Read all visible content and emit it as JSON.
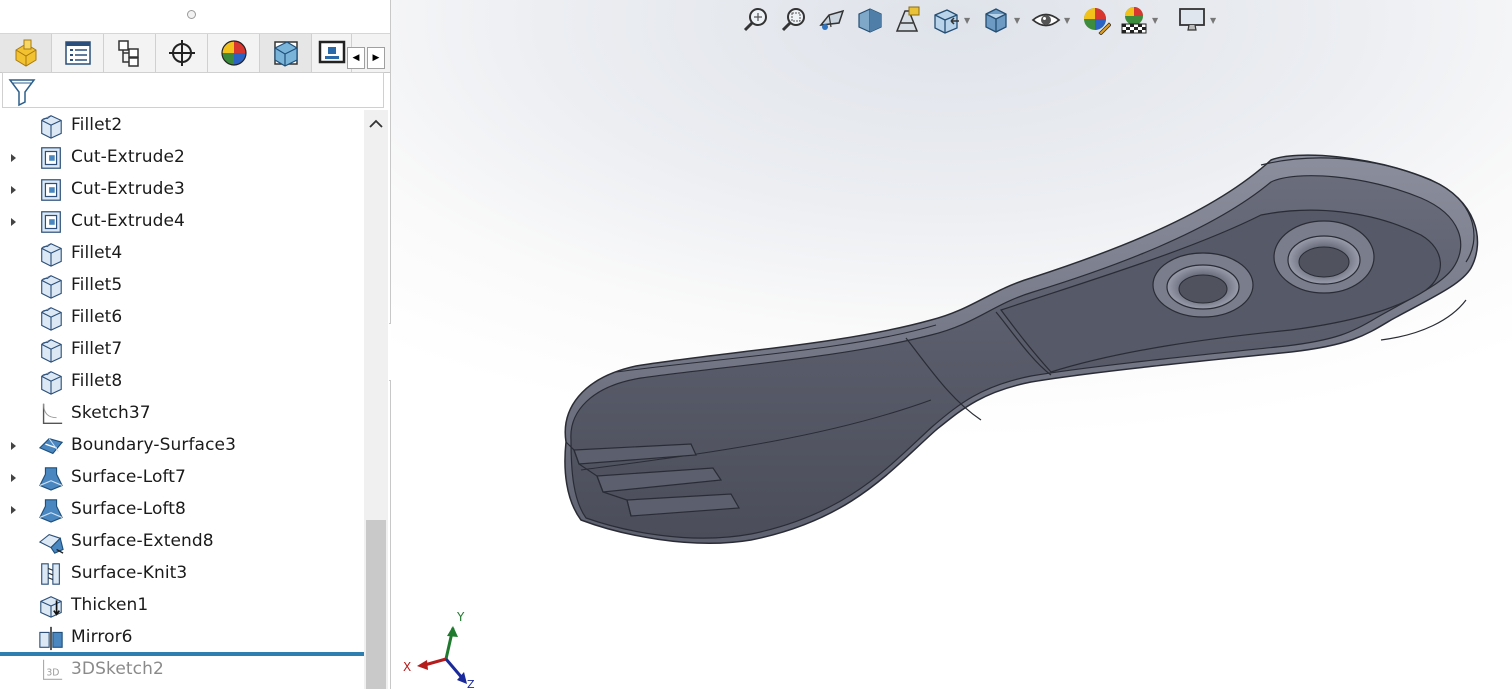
{
  "feature_tree": {
    "items": [
      {
        "label": "Fillet2",
        "icon": "fillet-icon",
        "expandable": false
      },
      {
        "label": "Cut-Extrude2",
        "icon": "cut-extrude-icon",
        "expandable": true
      },
      {
        "label": "Cut-Extrude3",
        "icon": "cut-extrude-icon",
        "expandable": true
      },
      {
        "label": "Cut-Extrude4",
        "icon": "cut-extrude-icon",
        "expandable": true
      },
      {
        "label": "Fillet4",
        "icon": "fillet-icon",
        "expandable": false
      },
      {
        "label": "Fillet5",
        "icon": "fillet-icon",
        "expandable": false
      },
      {
        "label": "Fillet6",
        "icon": "fillet-icon",
        "expandable": false
      },
      {
        "label": "Fillet7",
        "icon": "fillet-icon",
        "expandable": false
      },
      {
        "label": "Fillet8",
        "icon": "fillet-icon",
        "expandable": false
      },
      {
        "label": "Sketch37",
        "icon": "sketch-icon",
        "expandable": false
      },
      {
        "label": "Boundary-Surface3",
        "icon": "boundary-surface-icon",
        "expandable": true
      },
      {
        "label": "Surface-Loft7",
        "icon": "surface-loft-icon",
        "expandable": true
      },
      {
        "label": "Surface-Loft8",
        "icon": "surface-loft-icon",
        "expandable": true
      },
      {
        "label": "Surface-Extend8",
        "icon": "surface-extend-icon",
        "expandable": false
      },
      {
        "label": "Surface-Knit3",
        "icon": "surface-knit-icon",
        "expandable": false
      },
      {
        "label": "Thicken1",
        "icon": "thicken-icon",
        "expandable": false
      },
      {
        "label": "Mirror6",
        "icon": "mirror-icon",
        "expandable": false
      },
      {
        "label": "3DSketch2",
        "icon": "3d-sketch-icon",
        "expandable": false,
        "suppressed": true
      }
    ]
  },
  "tabs": [
    {
      "name": "feature-manager-tab",
      "icon": "part-icon",
      "active": true
    },
    {
      "name": "property-manager-tab",
      "icon": "property-list-icon"
    },
    {
      "name": "configuration-manager-tab",
      "icon": "configuration-icon"
    },
    {
      "name": "dimxpert-manager-tab",
      "icon": "crosshair-icon"
    },
    {
      "name": "display-manager-tab",
      "icon": "appearance-sphere-icon"
    },
    {
      "name": "cam-tab",
      "icon": "cube-section-icon"
    },
    {
      "name": "extra-tab",
      "icon": "screen-icon"
    }
  ],
  "triad": {
    "x_label": "X",
    "y_label": "Y",
    "z_label": "Z"
  },
  "colors": {
    "rollback_bar": "#2e7fb0",
    "model_face": "#5a5d6b",
    "tree_text": "#1a1a1a"
  }
}
